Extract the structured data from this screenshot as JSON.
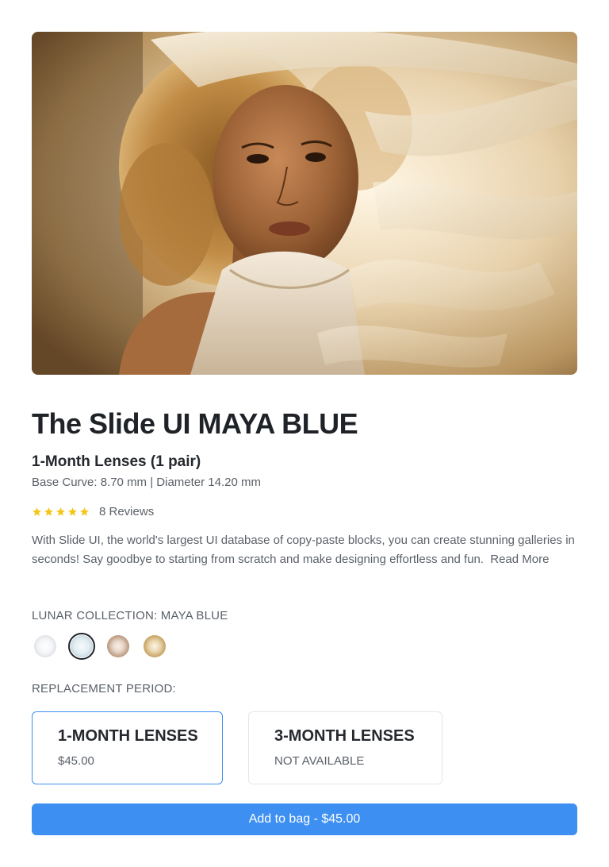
{
  "product": {
    "title": "The Slide UI MAYA BLUE",
    "subtitle": "1-Month Lenses (1 pair)",
    "specs": "Base Curve: 8.70 mm | Diameter 14.20 mm",
    "rating": 5,
    "reviews_label": "8 Reviews",
    "description": "With Slide UI, the world's largest UI database of copy-paste blocks, you can create stunning galleries in seconds! Say goodbye to starting from scratch and make designing effortless and fun.",
    "read_more_label": "Read More"
  },
  "color_section": {
    "label": "LUNAR COLLECTION: MAYA BLUE",
    "swatches": [
      {
        "name": "clear",
        "color": "#e9ebee",
        "selected": false
      },
      {
        "name": "maya-blue",
        "color": "#d6e4ea",
        "selected": true
      },
      {
        "name": "hazel",
        "color": "#c8ad96",
        "selected": false
      },
      {
        "name": "honey",
        "color": "#cfb37e",
        "selected": false
      }
    ]
  },
  "period_section": {
    "label": "REPLACEMENT PERIOD:",
    "options": [
      {
        "title": "1-MONTH LENSES",
        "subtitle": "$45.00",
        "selected": true
      },
      {
        "title": "3-MONTH LENSES",
        "subtitle": "NOT AVAILABLE",
        "selected": false
      }
    ]
  },
  "cta": {
    "label": "Add to bag - $45.00"
  },
  "colors": {
    "accent": "#3d8ff2",
    "star": "#f5c518",
    "text_primary": "#1f2328",
    "text_secondary": "#5b6168"
  }
}
